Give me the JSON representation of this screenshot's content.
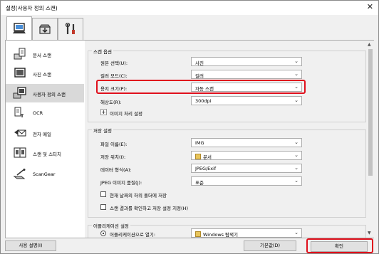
{
  "window": {
    "title": "설정(사용자 정의 스캔)",
    "close_glyph": "✕"
  },
  "top_tabs": [
    {
      "icon": "scan-from-computer-icon",
      "active": true
    },
    {
      "icon": "scan-from-operation-panel-icon",
      "active": false
    },
    {
      "icon": "tools-icon",
      "active": false
    }
  ],
  "sidebar": {
    "items": [
      {
        "label": "문서 스캔",
        "icon": "document-scan-icon"
      },
      {
        "label": "사진 스캔",
        "icon": "photo-scan-icon"
      },
      {
        "label": "사용자 정의 스캔",
        "icon": "custom-scan-icon",
        "selected": true
      },
      {
        "label": "OCR",
        "icon": "ocr-icon"
      },
      {
        "label": "전자 메일",
        "icon": "email-icon"
      },
      {
        "label": "스캔 및 스티치",
        "icon": "scan-and-stitch-icon"
      },
      {
        "label": "ScanGear",
        "icon": "scangear-icon"
      }
    ]
  },
  "scan_options": {
    "title": "스캔 옵션",
    "source_label": "원본 선택(U):",
    "source_value": "사진",
    "color_label": "컬러 모드(C):",
    "color_value": "컬러",
    "paper_label": "용지 크기(P):",
    "paper_value": "자동 스캔",
    "resolution_label": "해상도(R):",
    "resolution_value": "300dpi",
    "image_processing_label": "이미지 처리 설정",
    "plus": "+"
  },
  "save_settings": {
    "title": "저장 설정",
    "filename_label": "파일 이름(E):",
    "filename_value": "IMG",
    "save_in_label": "저장 위치(I):",
    "save_in_value": "문서",
    "format_label": "데이터 형식(A):",
    "format_value": "JPEG/Exif",
    "quality_label": "JPEG 이미지 품질(J):",
    "quality_value": "표준",
    "subfolder_label": "현재 날짜의 하위 폴더에 저장",
    "check_results_label": "스캔 결과를 확인하고 저장 설정 지정(H)"
  },
  "app_settings": {
    "title": "어플리케이션 설정",
    "open_with_label": "어플리케이션으로 열기:",
    "open_with_value": "Windows 탐색기"
  },
  "buttons": {
    "instructions": "사용 설명(I)",
    "defaults": "기본값(D)",
    "ok": "확인"
  },
  "combo_arrow": "⌄",
  "colors": {
    "highlight": "#e0101c",
    "selected_nav": "#d9d9d9",
    "folder": "#e8c45a",
    "accent": "#2a7fd4"
  }
}
